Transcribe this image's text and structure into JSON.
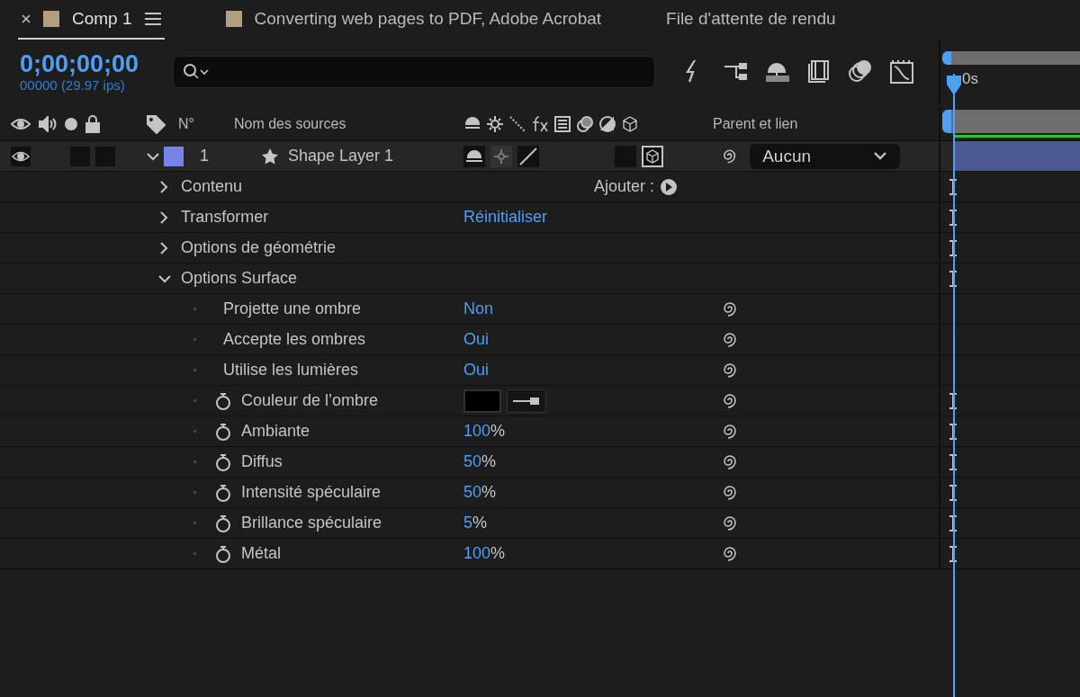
{
  "tabs": [
    {
      "label": "Comp 1",
      "kind": "comp",
      "selected": true
    },
    {
      "label": "Converting web pages to PDF, Adobe Acrobat",
      "kind": "comp",
      "selected": false
    },
    {
      "label": "File d'attente de rendu",
      "kind": "panel",
      "selected": false
    }
  ],
  "timecode": "0;00;00;00",
  "frame_info": "00000 (29.97 ips)",
  "columns": {
    "number": "N°",
    "source_name": "Nom des sources",
    "parent": "Parent et lien"
  },
  "timeline": {
    "ruler_label": "0s"
  },
  "layer": {
    "number": "1",
    "name": "Shape Layer 1",
    "visible": true,
    "solo": false,
    "locked": false,
    "expanded": true,
    "color": "#7584e6",
    "parent": "Aucun",
    "switches": [
      {
        "kind": "shy",
        "on": true
      },
      {
        "kind": "collapse",
        "on": false
      },
      {
        "kind": "quality",
        "on": true
      },
      {
        "kind": "adjustment",
        "on": false
      },
      {
        "kind": "three_d",
        "on": true
      }
    ]
  },
  "properties": [
    {
      "kind": "group",
      "name": "Contenu",
      "expanded": false,
      "action": "Ajouter :",
      "timeline_marker": true
    },
    {
      "kind": "group",
      "name": "Transformer",
      "expanded": false,
      "value": "Réinitialiser",
      "timeline_marker": true
    },
    {
      "kind": "group",
      "name": "Options de géométrie",
      "expanded": false,
      "timeline_marker": true
    },
    {
      "kind": "group",
      "name": "Options Surface",
      "expanded": true,
      "timeline_marker": true,
      "children": [
        {
          "kind": "toggle",
          "name": "Projette une ombre",
          "value": "Non",
          "timeline_marker": false
        },
        {
          "kind": "toggle",
          "name": "Accepte les ombres",
          "value": "Oui",
          "timeline_marker": false
        },
        {
          "kind": "toggle",
          "name": "Utilise les lumières",
          "value": "Oui",
          "timeline_marker": false
        },
        {
          "kind": "color",
          "name": "Couleur de l’ombre",
          "color": "#000000",
          "timeline_marker": true
        },
        {
          "kind": "percent",
          "name": "Ambiante",
          "value": "100",
          "unit": "%",
          "timeline_marker": true
        },
        {
          "kind": "percent",
          "name": "Diffus",
          "value": "50",
          "unit": "%",
          "timeline_marker": true
        },
        {
          "kind": "percent",
          "name": "Intensité spéculaire",
          "value": "50",
          "unit": "%",
          "timeline_marker": true
        },
        {
          "kind": "percent",
          "name": "Brillance spéculaire",
          "value": "5",
          "unit": "%",
          "timeline_marker": true
        },
        {
          "kind": "percent",
          "name": "Métal",
          "value": "100",
          "unit": "%",
          "timeline_marker": true
        }
      ]
    }
  ]
}
